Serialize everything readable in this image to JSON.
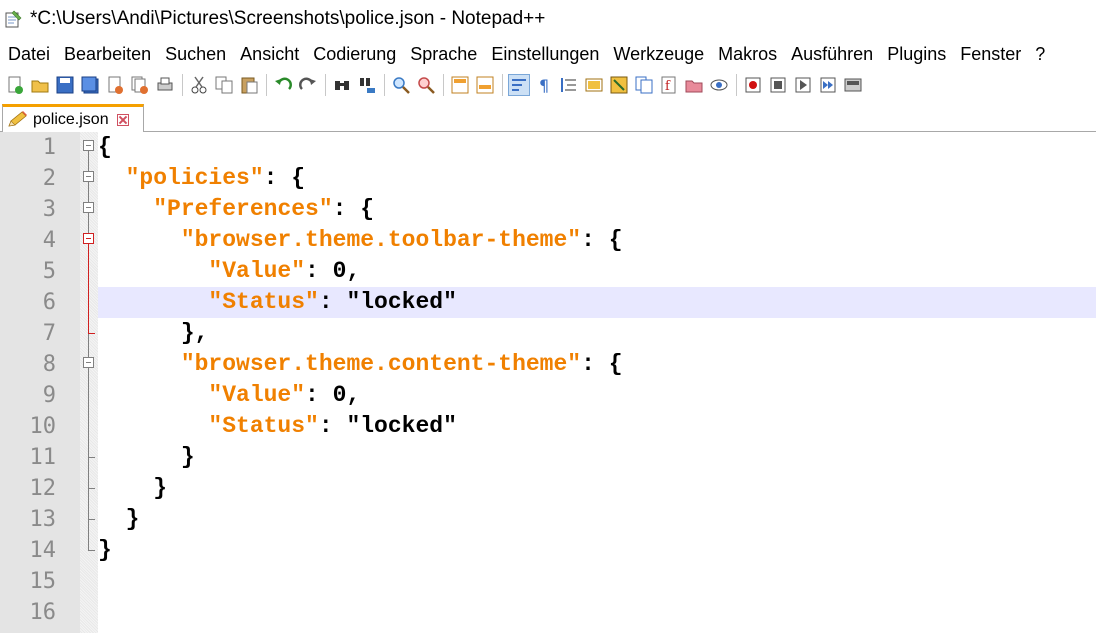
{
  "window": {
    "title": "*C:\\Users\\Andi\\Pictures\\Screenshots\\police.json - Notepad++"
  },
  "menu": [
    "Datei",
    "Bearbeiten",
    "Suchen",
    "Ansicht",
    "Codierung",
    "Sprache",
    "Einstellungen",
    "Werkzeuge",
    "Makros",
    "Ausführen",
    "Plugins",
    "Fenster",
    "?"
  ],
  "toolbar": {
    "groups": [
      [
        "new-file-icon",
        "open-file-icon",
        "save-icon",
        "save-all-icon",
        "close-icon",
        "close-all-icon",
        "print-icon"
      ],
      [
        "cut-icon",
        "copy-icon",
        "paste-icon"
      ],
      [
        "undo-icon",
        "redo-icon"
      ],
      [
        "find-icon",
        "replace-icon"
      ],
      [
        "zoom-in-icon",
        "zoom-out-icon"
      ],
      [
        "sync-vertical-icon",
        "sync-horizontal-icon"
      ],
      [
        "word-wrap-icon",
        "show-all-chars-icon",
        "indent-guide-icon",
        "udl-icon",
        "doc-map-icon",
        "function-list-icon",
        "folder-as-workspace-icon",
        "doc-list-icon",
        "monitor-icon"
      ],
      [
        "record-macro-icon",
        "stop-record-icon",
        "play-macro-icon",
        "run-multiple-macro-icon",
        "save-macro-icon"
      ]
    ],
    "active": "word-wrap-icon"
  },
  "tab": {
    "label": "police.json",
    "icon": "pencil-modified-icon"
  },
  "editor": {
    "current_line": 6,
    "lines": [
      {
        "num": "1",
        "segments": [
          {
            "t": "{",
            "c": "p"
          }
        ]
      },
      {
        "num": "2",
        "segments": [
          {
            "t": "  ",
            "c": "p"
          },
          {
            "t": "\"policies\"",
            "c": "s"
          },
          {
            "t": ": {",
            "c": "p"
          }
        ]
      },
      {
        "num": "3",
        "segments": [
          {
            "t": "    ",
            "c": "p"
          },
          {
            "t": "\"Preferences\"",
            "c": "s"
          },
          {
            "t": ": {",
            "c": "p"
          }
        ]
      },
      {
        "num": "4",
        "segments": [
          {
            "t": "      ",
            "c": "p"
          },
          {
            "t": "\"browser.theme.toolbar-theme\"",
            "c": "s"
          },
          {
            "t": ": {",
            "c": "p"
          }
        ]
      },
      {
        "num": "5",
        "segments": [
          {
            "t": "        ",
            "c": "p"
          },
          {
            "t": "\"Value\"",
            "c": "s"
          },
          {
            "t": ": 0,",
            "c": "p"
          }
        ]
      },
      {
        "num": "6",
        "segments": [
          {
            "t": "        ",
            "c": "p"
          },
          {
            "t": "\"Status\"",
            "c": "s"
          },
          {
            "t": ": \"locked\"",
            "c": "p"
          }
        ]
      },
      {
        "num": "7",
        "segments": [
          {
            "t": "      },",
            "c": "p"
          }
        ]
      },
      {
        "num": "8",
        "segments": [
          {
            "t": "      ",
            "c": "p"
          },
          {
            "t": "\"browser.theme.content-theme\"",
            "c": "s"
          },
          {
            "t": ": {",
            "c": "p"
          }
        ]
      },
      {
        "num": "9",
        "segments": [
          {
            "t": "        ",
            "c": "p"
          },
          {
            "t": "\"Value\"",
            "c": "s"
          },
          {
            "t": ": 0,",
            "c": "p"
          }
        ]
      },
      {
        "num": "10",
        "segments": [
          {
            "t": "        ",
            "c": "p"
          },
          {
            "t": "\"Status\"",
            "c": "s"
          },
          {
            "t": ": \"locked\"",
            "c": "p"
          }
        ]
      },
      {
        "num": "11",
        "segments": [
          {
            "t": "      }",
            "c": "p"
          }
        ]
      },
      {
        "num": "12",
        "segments": [
          {
            "t": "    }",
            "c": "p"
          }
        ]
      },
      {
        "num": "13",
        "segments": [
          {
            "t": "  }",
            "c": "p"
          }
        ]
      },
      {
        "num": "14",
        "segments": [
          {
            "t": "}",
            "c": "p"
          }
        ]
      },
      {
        "num": "15",
        "segments": []
      },
      {
        "num": "16",
        "segments": []
      }
    ]
  },
  "colors": {
    "string": "#f08000",
    "current_line": "#e8e8ff",
    "gutter": "#e4e4e4",
    "tab_accent": "#f5a000",
    "fold_active": "#d02020"
  }
}
